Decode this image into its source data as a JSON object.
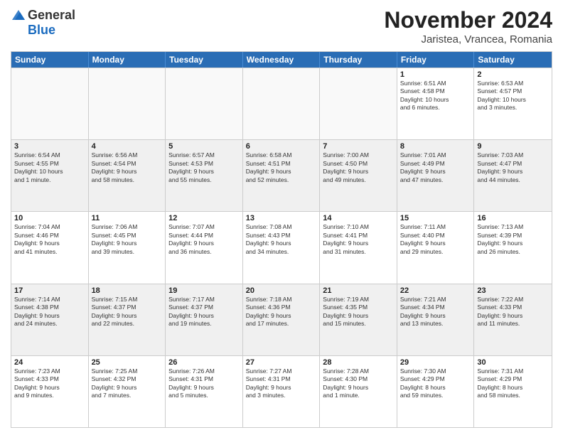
{
  "header": {
    "logo_general": "General",
    "logo_blue": "Blue",
    "month_title": "November 2024",
    "location": "Jaristea, Vrancea, Romania"
  },
  "weekdays": [
    "Sunday",
    "Monday",
    "Tuesday",
    "Wednesday",
    "Thursday",
    "Friday",
    "Saturday"
  ],
  "rows": [
    [
      {
        "day": "",
        "detail": "",
        "empty": true
      },
      {
        "day": "",
        "detail": "",
        "empty": true
      },
      {
        "day": "",
        "detail": "",
        "empty": true
      },
      {
        "day": "",
        "detail": "",
        "empty": true
      },
      {
        "day": "",
        "detail": "",
        "empty": true
      },
      {
        "day": "1",
        "detail": "Sunrise: 6:51 AM\nSunset: 4:58 PM\nDaylight: 10 hours\nand 6 minutes.",
        "empty": false
      },
      {
        "day": "2",
        "detail": "Sunrise: 6:53 AM\nSunset: 4:57 PM\nDaylight: 10 hours\nand 3 minutes.",
        "empty": false
      }
    ],
    [
      {
        "day": "3",
        "detail": "Sunrise: 6:54 AM\nSunset: 4:55 PM\nDaylight: 10 hours\nand 1 minute.",
        "empty": false
      },
      {
        "day": "4",
        "detail": "Sunrise: 6:56 AM\nSunset: 4:54 PM\nDaylight: 9 hours\nand 58 minutes.",
        "empty": false
      },
      {
        "day": "5",
        "detail": "Sunrise: 6:57 AM\nSunset: 4:53 PM\nDaylight: 9 hours\nand 55 minutes.",
        "empty": false
      },
      {
        "day": "6",
        "detail": "Sunrise: 6:58 AM\nSunset: 4:51 PM\nDaylight: 9 hours\nand 52 minutes.",
        "empty": false
      },
      {
        "day": "7",
        "detail": "Sunrise: 7:00 AM\nSunset: 4:50 PM\nDaylight: 9 hours\nand 49 minutes.",
        "empty": false
      },
      {
        "day": "8",
        "detail": "Sunrise: 7:01 AM\nSunset: 4:49 PM\nDaylight: 9 hours\nand 47 minutes.",
        "empty": false
      },
      {
        "day": "9",
        "detail": "Sunrise: 7:03 AM\nSunset: 4:47 PM\nDaylight: 9 hours\nand 44 minutes.",
        "empty": false
      }
    ],
    [
      {
        "day": "10",
        "detail": "Sunrise: 7:04 AM\nSunset: 4:46 PM\nDaylight: 9 hours\nand 41 minutes.",
        "empty": false
      },
      {
        "day": "11",
        "detail": "Sunrise: 7:06 AM\nSunset: 4:45 PM\nDaylight: 9 hours\nand 39 minutes.",
        "empty": false
      },
      {
        "day": "12",
        "detail": "Sunrise: 7:07 AM\nSunset: 4:44 PM\nDaylight: 9 hours\nand 36 minutes.",
        "empty": false
      },
      {
        "day": "13",
        "detail": "Sunrise: 7:08 AM\nSunset: 4:43 PM\nDaylight: 9 hours\nand 34 minutes.",
        "empty": false
      },
      {
        "day": "14",
        "detail": "Sunrise: 7:10 AM\nSunset: 4:41 PM\nDaylight: 9 hours\nand 31 minutes.",
        "empty": false
      },
      {
        "day": "15",
        "detail": "Sunrise: 7:11 AM\nSunset: 4:40 PM\nDaylight: 9 hours\nand 29 minutes.",
        "empty": false
      },
      {
        "day": "16",
        "detail": "Sunrise: 7:13 AM\nSunset: 4:39 PM\nDaylight: 9 hours\nand 26 minutes.",
        "empty": false
      }
    ],
    [
      {
        "day": "17",
        "detail": "Sunrise: 7:14 AM\nSunset: 4:38 PM\nDaylight: 9 hours\nand 24 minutes.",
        "empty": false
      },
      {
        "day": "18",
        "detail": "Sunrise: 7:15 AM\nSunset: 4:37 PM\nDaylight: 9 hours\nand 22 minutes.",
        "empty": false
      },
      {
        "day": "19",
        "detail": "Sunrise: 7:17 AM\nSunset: 4:37 PM\nDaylight: 9 hours\nand 19 minutes.",
        "empty": false
      },
      {
        "day": "20",
        "detail": "Sunrise: 7:18 AM\nSunset: 4:36 PM\nDaylight: 9 hours\nand 17 minutes.",
        "empty": false
      },
      {
        "day": "21",
        "detail": "Sunrise: 7:19 AM\nSunset: 4:35 PM\nDaylight: 9 hours\nand 15 minutes.",
        "empty": false
      },
      {
        "day": "22",
        "detail": "Sunrise: 7:21 AM\nSunset: 4:34 PM\nDaylight: 9 hours\nand 13 minutes.",
        "empty": false
      },
      {
        "day": "23",
        "detail": "Sunrise: 7:22 AM\nSunset: 4:33 PM\nDaylight: 9 hours\nand 11 minutes.",
        "empty": false
      }
    ],
    [
      {
        "day": "24",
        "detail": "Sunrise: 7:23 AM\nSunset: 4:33 PM\nDaylight: 9 hours\nand 9 minutes.",
        "empty": false
      },
      {
        "day": "25",
        "detail": "Sunrise: 7:25 AM\nSunset: 4:32 PM\nDaylight: 9 hours\nand 7 minutes.",
        "empty": false
      },
      {
        "day": "26",
        "detail": "Sunrise: 7:26 AM\nSunset: 4:31 PM\nDaylight: 9 hours\nand 5 minutes.",
        "empty": false
      },
      {
        "day": "27",
        "detail": "Sunrise: 7:27 AM\nSunset: 4:31 PM\nDaylight: 9 hours\nand 3 minutes.",
        "empty": false
      },
      {
        "day": "28",
        "detail": "Sunrise: 7:28 AM\nSunset: 4:30 PM\nDaylight: 9 hours\nand 1 minute.",
        "empty": false
      },
      {
        "day": "29",
        "detail": "Sunrise: 7:30 AM\nSunset: 4:29 PM\nDaylight: 8 hours\nand 59 minutes.",
        "empty": false
      },
      {
        "day": "30",
        "detail": "Sunrise: 7:31 AM\nSunset: 4:29 PM\nDaylight: 8 hours\nand 58 minutes.",
        "empty": false
      }
    ]
  ]
}
